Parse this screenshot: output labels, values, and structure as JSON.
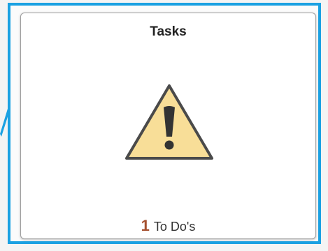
{
  "tile": {
    "title": "Tasks",
    "icon": "warning-triangle-icon",
    "count": "1",
    "count_label": "To Do's"
  },
  "colors": {
    "highlight_border": "#1ba1e2",
    "icon_fill": "#f8de98",
    "icon_stroke": "#4a4a4a",
    "count_color": "#a5502f"
  }
}
